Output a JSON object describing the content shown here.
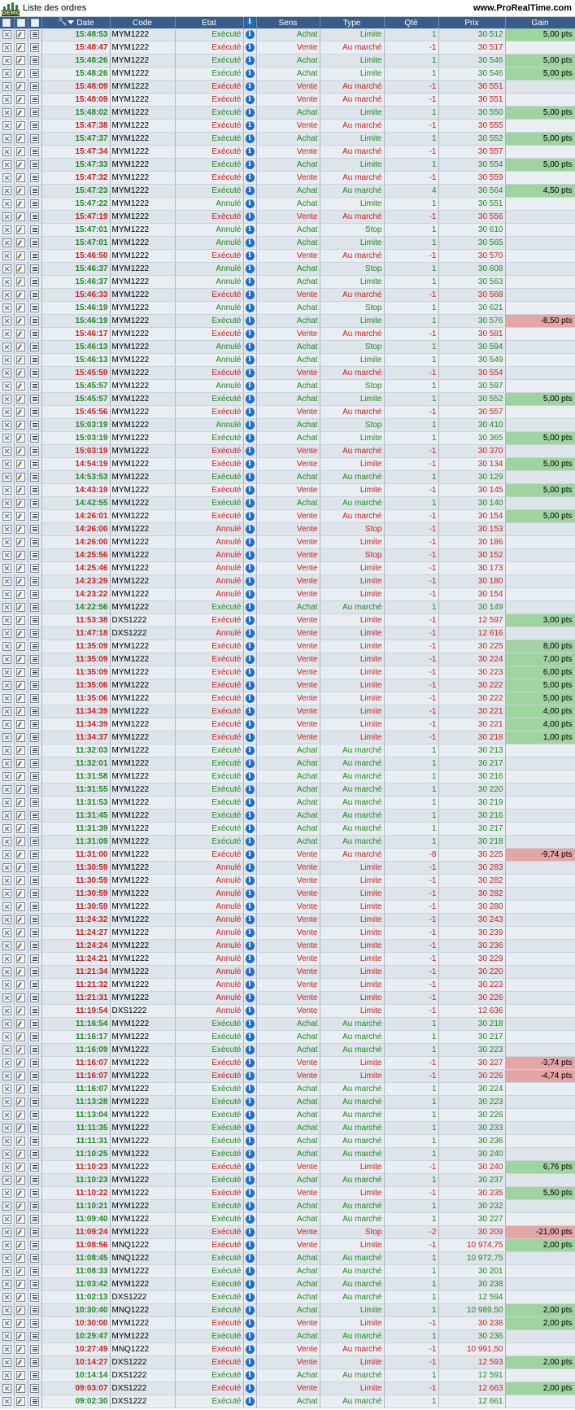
{
  "app": {
    "title": "Liste des ordres",
    "badge": "DEMO",
    "site": "www.ProRealTime.com"
  },
  "columns": {
    "date": "Date",
    "code": "Code",
    "etat": "Etat",
    "sens": "Sens",
    "type": "Type",
    "qte": "Qté",
    "prix": "Prix",
    "gain": "Gain"
  },
  "colors": {
    "header_bg": "#385d8a",
    "buy_text": "#1f8a1f",
    "sell_text": "#cc1f1f",
    "gain_positive_bg": "#9fd39f",
    "gain_negative_bg": "#e3a5a5",
    "info_icon": "#1f6fc6"
  },
  "icons": {
    "row_cancel": "cancel-order-icon",
    "row_edit": "edit-order-icon",
    "row_detail": "order-detail-icon",
    "info": "info-icon",
    "settings": "wrench-icon",
    "sort": "sort-descending-icon"
  },
  "orders": [
    [
      "15:48:53",
      "MYM1222",
      "Exécuté",
      "Achat",
      "Limite",
      "1",
      "30 512",
      "5,00 pts"
    ],
    [
      "15:48:47",
      "MYM1222",
      "Exécuté",
      "Vente",
      "Au marché",
      "-1",
      "30 517",
      ""
    ],
    [
      "15:48:26",
      "MYM1222",
      "Exécuté",
      "Achat",
      "Limite",
      "1",
      "30 546",
      "5,00 pts"
    ],
    [
      "15:48:26",
      "MYM1222",
      "Exécuté",
      "Achat",
      "Limite",
      "1",
      "30 546",
      "5,00 pts"
    ],
    [
      "15:48:09",
      "MYM1222",
      "Exécuté",
      "Vente",
      "Au marché",
      "-1",
      "30 551",
      ""
    ],
    [
      "15:48:09",
      "MYM1222",
      "Exécuté",
      "Vente",
      "Au marché",
      "-1",
      "30 551",
      ""
    ],
    [
      "15:48:02",
      "MYM1222",
      "Exécuté",
      "Achat",
      "Limite",
      "1",
      "30 550",
      "5,00 pts"
    ],
    [
      "15:47:38",
      "MYM1222",
      "Exécuté",
      "Vente",
      "Au marché",
      "-1",
      "30 555",
      ""
    ],
    [
      "15:47:37",
      "MYM1222",
      "Exécuté",
      "Achat",
      "Limite",
      "1",
      "30 552",
      "5,00 pts"
    ],
    [
      "15:47:34",
      "MYM1222",
      "Exécuté",
      "Vente",
      "Au marché",
      "-1",
      "30 557",
      ""
    ],
    [
      "15:47:33",
      "MYM1222",
      "Exécuté",
      "Achat",
      "Limite",
      "1",
      "30 554",
      "5,00 pts"
    ],
    [
      "15:47:32",
      "MYM1222",
      "Exécuté",
      "Vente",
      "Au marché",
      "-1",
      "30 559",
      ""
    ],
    [
      "15:47:23",
      "MYM1222",
      "Exécuté",
      "Achat",
      "Au marché",
      "4",
      "30 564",
      "4,50 pts"
    ],
    [
      "15:47:22",
      "MYM1222",
      "Annulé",
      "Achat",
      "Limite",
      "1",
      "30 551",
      ""
    ],
    [
      "15:47:19",
      "MYM1222",
      "Exécuté",
      "Vente",
      "Au marché",
      "-1",
      "30 556",
      ""
    ],
    [
      "15:47:01",
      "MYM1222",
      "Annulé",
      "Achat",
      "Stop",
      "1",
      "30 610",
      ""
    ],
    [
      "15:47:01",
      "MYM1222",
      "Annulé",
      "Achat",
      "Limite",
      "1",
      "30 565",
      ""
    ],
    [
      "15:46:50",
      "MYM1222",
      "Exécuté",
      "Vente",
      "Au marché",
      "-1",
      "30 570",
      ""
    ],
    [
      "15:46:37",
      "MYM1222",
      "Annulé",
      "Achat",
      "Stop",
      "1",
      "30 608",
      ""
    ],
    [
      "15:46:37",
      "MYM1222",
      "Annulé",
      "Achat",
      "Limite",
      "1",
      "30 563",
      ""
    ],
    [
      "15:46:33",
      "MYM1222",
      "Exécuté",
      "Vente",
      "Au marché",
      "-1",
      "30 568",
      ""
    ],
    [
      "15:46:19",
      "MYM1222",
      "Annulé",
      "Achat",
      "Stop",
      "1",
      "30 621",
      ""
    ],
    [
      "15:46:19",
      "MYM1222",
      "Exécuté",
      "Achat",
      "Limite",
      "1",
      "30 576",
      "-8,50 pts"
    ],
    [
      "15:46:17",
      "MYM1222",
      "Exécuté",
      "Vente",
      "Au marché",
      "-1",
      "30 581",
      ""
    ],
    [
      "15:46:13",
      "MYM1222",
      "Annulé",
      "Achat",
      "Stop",
      "1",
      "30 594",
      ""
    ],
    [
      "15:46:13",
      "MYM1222",
      "Annulé",
      "Achat",
      "Limite",
      "1",
      "30 549",
      ""
    ],
    [
      "15:45:59",
      "MYM1222",
      "Exécuté",
      "Vente",
      "Au marché",
      "-1",
      "30 554",
      ""
    ],
    [
      "15:45:57",
      "MYM1222",
      "Annulé",
      "Achat",
      "Stop",
      "1",
      "30 597",
      ""
    ],
    [
      "15:45:57",
      "MYM1222",
      "Exécuté",
      "Achat",
      "Limite",
      "1",
      "30 552",
      "5,00 pts"
    ],
    [
      "15:45:56",
      "MYM1222",
      "Exécuté",
      "Vente",
      "Au marché",
      "-1",
      "30 557",
      ""
    ],
    [
      "15:03:19",
      "MYM1222",
      "Annulé",
      "Achat",
      "Stop",
      "1",
      "30 410",
      ""
    ],
    [
      "15:03:19",
      "MYM1222",
      "Exécuté",
      "Achat",
      "Limite",
      "1",
      "30 365",
      "5,00 pts"
    ],
    [
      "15:03:19",
      "MYM1222",
      "Exécuté",
      "Vente",
      "Au marché",
      "-1",
      "30 370",
      ""
    ],
    [
      "14:54:19",
      "MYM1222",
      "Exécuté",
      "Vente",
      "Limite",
      "-1",
      "30 134",
      "5,00 pts"
    ],
    [
      "14:53:53",
      "MYM1222",
      "Exécuté",
      "Achat",
      "Au marché",
      "1",
      "30 129",
      ""
    ],
    [
      "14:43:19",
      "MYM1222",
      "Exécuté",
      "Vente",
      "Limite",
      "-1",
      "30 145",
      "5,00 pts"
    ],
    [
      "14:42:55",
      "MYM1222",
      "Exécuté",
      "Achat",
      "Au marché",
      "1",
      "30 140",
      ""
    ],
    [
      "14:26:01",
      "MYM1222",
      "Exécuté",
      "Vente",
      "Au marché",
      "-1",
      "30 154",
      "5,00 pts"
    ],
    [
      "14:26:00",
      "MYM1222",
      "Annulé",
      "Vente",
      "Stop",
      "-1",
      "30 153",
      ""
    ],
    [
      "14:26:00",
      "MYM1222",
      "Annulé",
      "Vente",
      "Limite",
      "-1",
      "30 186",
      ""
    ],
    [
      "14:25:56",
      "MYM1222",
      "Annulé",
      "Vente",
      "Stop",
      "-1",
      "30 152",
      ""
    ],
    [
      "14:25:46",
      "MYM1222",
      "Annulé",
      "Vente",
      "Limite",
      "-1",
      "30 173",
      ""
    ],
    [
      "14:23:29",
      "MYM1222",
      "Annulé",
      "Vente",
      "Limite",
      "-1",
      "30 180",
      ""
    ],
    [
      "14:23:22",
      "MYM1222",
      "Annulé",
      "Vente",
      "Limite",
      "-1",
      "30 154",
      ""
    ],
    [
      "14:22:56",
      "MYM1222",
      "Exécuté",
      "Achat",
      "Au marché",
      "1",
      "30 149",
      ""
    ],
    [
      "11:53:38",
      "DXS1222",
      "Exécuté",
      "Vente",
      "Limite",
      "-1",
      "12 597",
      "3,00 pts"
    ],
    [
      "11:47:18",
      "DXS1222",
      "Annulé",
      "Vente",
      "Limite",
      "-1",
      "12 616",
      ""
    ],
    [
      "11:35:09",
      "MYM1222",
      "Exécuté",
      "Vente",
      "Limite",
      "-1",
      "30 225",
      "8,00 pts"
    ],
    [
      "11:35:09",
      "MYM1222",
      "Exécuté",
      "Vente",
      "Limite",
      "-1",
      "30 224",
      "7,00 pts"
    ],
    [
      "11:35:09",
      "MYM1222",
      "Exécuté",
      "Vente",
      "Limite",
      "-1",
      "30 223",
      "6,00 pts"
    ],
    [
      "11:35:06",
      "MYM1222",
      "Exécuté",
      "Vente",
      "Limite",
      "-1",
      "30 222",
      "5,00 pts"
    ],
    [
      "11:35:06",
      "MYM1222",
      "Exécuté",
      "Vente",
      "Limite",
      "-1",
      "30 222",
      "5,00 pts"
    ],
    [
      "11:34:39",
      "MYM1222",
      "Exécuté",
      "Vente",
      "Limite",
      "-1",
      "30 221",
      "4,00 pts"
    ],
    [
      "11:34:39",
      "MYM1222",
      "Exécuté",
      "Vente",
      "Limite",
      "-1",
      "30 221",
      "4,00 pts"
    ],
    [
      "11:34:37",
      "MYM1222",
      "Exécuté",
      "Vente",
      "Limite",
      "-1",
      "30 218",
      "1,00 pts"
    ],
    [
      "11:32:03",
      "MYM1222",
      "Exécuté",
      "Achat",
      "Au marché",
      "1",
      "30 213",
      ""
    ],
    [
      "11:32:01",
      "MYM1222",
      "Exécuté",
      "Achat",
      "Au marché",
      "1",
      "30 217",
      ""
    ],
    [
      "11:31:58",
      "MYM1222",
      "Exécuté",
      "Achat",
      "Au marché",
      "1",
      "30 216",
      ""
    ],
    [
      "11:31:55",
      "MYM1222",
      "Exécuté",
      "Achat",
      "Au marché",
      "1",
      "30 220",
      ""
    ],
    [
      "11:31:53",
      "MYM1222",
      "Exécuté",
      "Achat",
      "Au marché",
      "1",
      "30 219",
      ""
    ],
    [
      "11:31:45",
      "MYM1222",
      "Exécuté",
      "Achat",
      "Au marché",
      "1",
      "30 216",
      ""
    ],
    [
      "11:31:39",
      "MYM1222",
      "Exécuté",
      "Achat",
      "Au marché",
      "1",
      "30 217",
      ""
    ],
    [
      "11:31:09",
      "MYM1222",
      "Exécuté",
      "Achat",
      "Au marché",
      "1",
      "30 218",
      ""
    ],
    [
      "11:31:00",
      "MYM1222",
      "Exécuté",
      "Vente",
      "Au marché",
      "-8",
      "30 225",
      "-9,74 pts"
    ],
    [
      "11:30:59",
      "MYM1222",
      "Annulé",
      "Vente",
      "Limite",
      "-1",
      "30 283",
      ""
    ],
    [
      "11:30:59",
      "MYM1222",
      "Annulé",
      "Vente",
      "Limite",
      "-1",
      "30 282",
      ""
    ],
    [
      "11:30:59",
      "MYM1222",
      "Annulé",
      "Vente",
      "Limite",
      "-1",
      "30 282",
      ""
    ],
    [
      "11:30:59",
      "MYM1222",
      "Annulé",
      "Vente",
      "Limite",
      "-1",
      "30 280",
      ""
    ],
    [
      "11:24:32",
      "MYM1222",
      "Annulé",
      "Vente",
      "Limite",
      "-1",
      "30 243",
      ""
    ],
    [
      "11:24:27",
      "MYM1222",
      "Annulé",
      "Vente",
      "Limite",
      "-1",
      "30 239",
      ""
    ],
    [
      "11:24:24",
      "MYM1222",
      "Annulé",
      "Vente",
      "Limite",
      "-1",
      "30 236",
      ""
    ],
    [
      "11:24:21",
      "MYM1222",
      "Annulé",
      "Vente",
      "Limite",
      "-1",
      "30 229",
      ""
    ],
    [
      "11:21:34",
      "MYM1222",
      "Annulé",
      "Vente",
      "Limite",
      "-1",
      "30 220",
      ""
    ],
    [
      "11:21:32",
      "MYM1222",
      "Annulé",
      "Vente",
      "Limite",
      "-1",
      "30 223",
      ""
    ],
    [
      "11:21:31",
      "MYM1222",
      "Annulé",
      "Vente",
      "Limite",
      "-1",
      "30 226",
      ""
    ],
    [
      "11:19:54",
      "DXS1222",
      "Annulé",
      "Vente",
      "Limite",
      "-1",
      "12 636",
      ""
    ],
    [
      "11:16:54",
      "MYM1222",
      "Exécuté",
      "Achat",
      "Au marché",
      "1",
      "30 218",
      ""
    ],
    [
      "11:16:17",
      "MYM1222",
      "Exécuté",
      "Achat",
      "Au marché",
      "1",
      "30 217",
      ""
    ],
    [
      "11:16:09",
      "MYM1222",
      "Exécuté",
      "Achat",
      "Au marché",
      "1",
      "30 223",
      ""
    ],
    [
      "11:16:07",
      "MYM1222",
      "Exécuté",
      "Vente",
      "Limite",
      "-1",
      "30 227",
      "-3,74 pts"
    ],
    [
      "11:16:07",
      "MYM1222",
      "Exécuté",
      "Vente",
      "Limite",
      "-1",
      "30 226",
      "-4,74 pts"
    ],
    [
      "11:16:07",
      "MYM1222",
      "Exécuté",
      "Achat",
      "Au marché",
      "1",
      "30 224",
      ""
    ],
    [
      "11:13:28",
      "MYM1222",
      "Exécuté",
      "Achat",
      "Au marché",
      "1",
      "30 223",
      ""
    ],
    [
      "11:13:04",
      "MYM1222",
      "Exécuté",
      "Achat",
      "Au marché",
      "1",
      "30 226",
      ""
    ],
    [
      "11:11:35",
      "MYM1222",
      "Exécuté",
      "Achat",
      "Au marché",
      "1",
      "30 233",
      ""
    ],
    [
      "11:11:31",
      "MYM1222",
      "Exécuté",
      "Achat",
      "Au marché",
      "1",
      "30 236",
      ""
    ],
    [
      "11:10:25",
      "MYM1222",
      "Exécuté",
      "Achat",
      "Au marché",
      "1",
      "30 240",
      ""
    ],
    [
      "11:10:23",
      "MYM1222",
      "Exécuté",
      "Vente",
      "Limite",
      "-1",
      "30 240",
      "6,76 pts"
    ],
    [
      "11:10:23",
      "MYM1222",
      "Exécuté",
      "Achat",
      "Au marché",
      "1",
      "30 237",
      ""
    ],
    [
      "11:10:22",
      "MYM1222",
      "Exécuté",
      "Vente",
      "Limite",
      "-1",
      "30 235",
      "5,50 pts"
    ],
    [
      "11:10:21",
      "MYM1222",
      "Exécuté",
      "Achat",
      "Au marché",
      "1",
      "30 232",
      ""
    ],
    [
      "11:09:40",
      "MYM1222",
      "Exécuté",
      "Achat",
      "Au marché",
      "1",
      "30 227",
      ""
    ],
    [
      "11:09:24",
      "MYM1222",
      "Exécuté",
      "Vente",
      "Stop",
      "-2",
      "30 209",
      "-21,00 pts"
    ],
    [
      "11:08:56",
      "MNQ1222",
      "Exécuté",
      "Vente",
      "Limite",
      "-1",
      "10 974,75",
      "2,00 pts"
    ],
    [
      "11:08:45",
      "MNQ1222",
      "Exécuté",
      "Achat",
      "Au marché",
      "1",
      "10 972,75",
      ""
    ],
    [
      "11:08:33",
      "MYM1222",
      "Exécuté",
      "Achat",
      "Au marché",
      "1",
      "30 201",
      ""
    ],
    [
      "11:03:42",
      "MYM1222",
      "Exécuté",
      "Achat",
      "Au marché",
      "1",
      "30 238",
      ""
    ],
    [
      "11:02:13",
      "DXS1222",
      "Exécuté",
      "Achat",
      "Au marché",
      "1",
      "12 594",
      ""
    ],
    [
      "10:30:40",
      "MNQ1222",
      "Exécuté",
      "Achat",
      "Limite",
      "1",
      "10 989,50",
      "2,00 pts"
    ],
    [
      "10:30:00",
      "MYM1222",
      "Exécuté",
      "Vente",
      "Limite",
      "-1",
      "30 238",
      "2,00 pts"
    ],
    [
      "10:29:47",
      "MYM1222",
      "Exécuté",
      "Achat",
      "Au marché",
      "1",
      "30 236",
      ""
    ],
    [
      "10:27:49",
      "MNQ1222",
      "Exécuté",
      "Vente",
      "Au marché",
      "-1",
      "10 991,50",
      ""
    ],
    [
      "10:14:27",
      "DXS1222",
      "Exécuté",
      "Vente",
      "Limite",
      "-1",
      "12 593",
      "2,00 pts"
    ],
    [
      "10:14:14",
      "DXS1222",
      "Exécuté",
      "Achat",
      "Au marché",
      "1",
      "12 591",
      ""
    ],
    [
      "09:03:07",
      "DXS1222",
      "Exécuté",
      "Vente",
      "Limite",
      "-1",
      "12 663",
      "2,00 pts"
    ],
    [
      "09:02:30",
      "DXS1222",
      "Exécuté",
      "Achat",
      "Au marché",
      "1",
      "12 661",
      ""
    ]
  ]
}
